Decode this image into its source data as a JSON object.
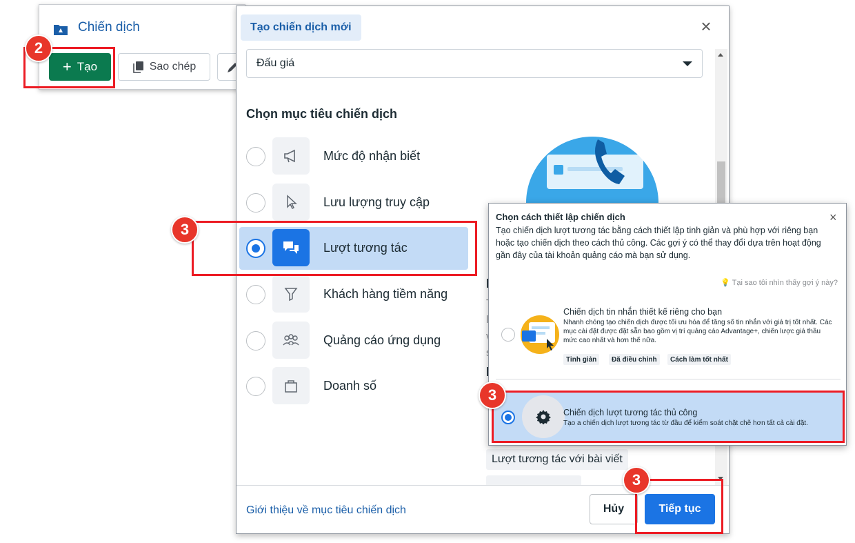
{
  "campaign_panel": {
    "title": "Chiến dịch",
    "create_label": "Tạo",
    "copy_label": "Sao chép"
  },
  "modal": {
    "title": "Tạo chiến dịch mới",
    "buying_type": "Đấu giá",
    "objective_heading": "Chọn mục tiêu chiến dịch",
    "objectives": [
      {
        "label": "Mức độ nhận biết",
        "icon": "megaphone-icon",
        "selected": false
      },
      {
        "label": "Lưu lượng truy cập",
        "icon": "cursor-icon",
        "selected": false
      },
      {
        "label": "Lượt tương tác",
        "icon": "chat-bubbles-icon",
        "selected": true
      },
      {
        "label": "Khách hàng tiềm năng",
        "icon": "filter-icon",
        "selected": false
      },
      {
        "label": "Quảng cáo ứng dụng",
        "icon": "people-group-icon",
        "selected": false
      },
      {
        "label": "Doanh số",
        "icon": "shopping-bag-icon",
        "selected": false
      }
    ],
    "partial_text": {
      "heading_l": "L",
      "heading_p": "P",
      "chars": [
        "T",
        "l",
        "v",
        "s"
      ]
    },
    "chip_post": "Lượt tương tác với bài viết",
    "learn_link": "Giới thiệu về mục tiêu chiến dịch",
    "cancel_label": "Hủy",
    "continue_label": "Tiếp tục"
  },
  "setup_popover": {
    "title": "Chọn cách thiết lập chiến dịch",
    "description": "Tạo chiến dịch lượt tương tác bằng cách thiết lập tinh giản và phù hợp với riêng bạn hoặc tạo chiến dịch theo cách thủ công. Các gợi ý có thể thay đổi dựa trên hoạt động gần đây của tài khoản quảng cáo mà bạn sử dụng.",
    "why_link": "Tại sao tôi nhìn thấy gợi ý này?",
    "option_tailored": {
      "title": "Chiến dịch tin nhắn thiết kế riêng cho bạn",
      "description": "Nhanh chóng tạo chiến dịch được tối ưu hóa để tăng số tin nhắn với giá trị tốt nhất. Các mục cài đặt được đặt sẵn bao gồm vị trí quảng cáo Advantage+, chiến lược giá thầu mức cao nhất và hơn thế nữa.",
      "tags": [
        "Tinh giản",
        "Đã điều chỉnh",
        "Cách làm tốt nhất"
      ],
      "selected": false
    },
    "option_manual": {
      "title": "Chiến dịch lượt tương tác thủ công",
      "description": "Tạo a chiến dịch lượt tương tác từ đầu để kiểm soát chặt chẽ hơn tất cả cài đặt.",
      "selected": true
    }
  },
  "annotations": {
    "badge_create": "2",
    "badge_objective": "3",
    "badge_manual": "3",
    "badge_continue": "3"
  },
  "colors": {
    "accent_blue": "#1b74e4",
    "create_green": "#0b7a4f",
    "annotation_red": "#ec1c24",
    "selected_bg": "#c3dbf6"
  }
}
